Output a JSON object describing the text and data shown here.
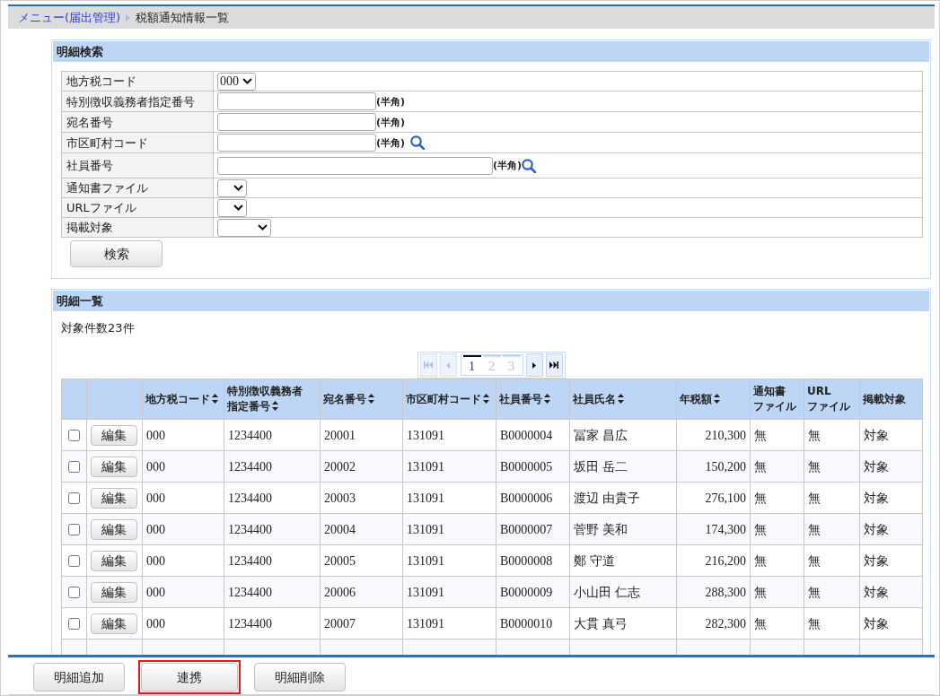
{
  "breadcrumb": {
    "link": "メニュー(届出管理)",
    "current": "税額通知情報一覧"
  },
  "search_panel": {
    "title": "明細検索",
    "fields": [
      {
        "label": "地方税コード",
        "kind": "select",
        "value": "000"
      },
      {
        "label": "特別徴収義務者指定番号",
        "kind": "text",
        "note": "(半角)"
      },
      {
        "label": "宛名番号",
        "kind": "text",
        "note": "(半角)"
      },
      {
        "label": "市区町村コード",
        "kind": "text",
        "note": "(半角)",
        "lookup": true
      },
      {
        "label": "社員番号",
        "kind": "long_text",
        "note": "(半角)",
        "lookup": true
      },
      {
        "label": "通知書ファイル",
        "kind": "select"
      },
      {
        "label": "URLファイル",
        "kind": "select"
      },
      {
        "label": "掲載対象",
        "kind": "wide_select"
      }
    ],
    "search_button": "検索"
  },
  "list_panel": {
    "title": "明細一覧",
    "count": "対象件数23件",
    "pager": {
      "first_disabled": true,
      "prev_disabled": true,
      "pages": [
        {
          "label": "1",
          "selected": true
        },
        {
          "label": "2",
          "selected": false
        },
        {
          "label": "3",
          "selected": false
        }
      ],
      "next_disabled": false,
      "last_disabled": false
    },
    "table": {
      "columns": [
        {
          "lines": [
            "地方税コード"
          ],
          "sortable": true,
          "kind": "code"
        },
        {
          "lines": [
            "特別徴収義務者",
            "指定番号"
          ],
          "sortable": true,
          "kind": "code"
        },
        {
          "lines": [
            "宛名番号"
          ],
          "sortable": true,
          "kind": "code"
        },
        {
          "lines": [
            "市区町村コード"
          ],
          "sortable": true,
          "kind": "code"
        },
        {
          "lines": [
            "社員番号"
          ],
          "sortable": true,
          "kind": "code"
        },
        {
          "lines": [
            "社員氏名"
          ],
          "sortable": true,
          "kind": "text"
        },
        {
          "lines": [
            "年税額"
          ],
          "sortable": true,
          "kind": "amount"
        },
        {
          "lines": [
            "通知書",
            "ファイル"
          ],
          "sortable": false,
          "kind": "text"
        },
        {
          "lines": [
            "URL",
            "ファイル"
          ],
          "sortable": false,
          "kind": "text"
        },
        {
          "lines": [
            "掲載対象"
          ],
          "sortable": false,
          "kind": "text"
        }
      ],
      "rows": [
        {
          "checked": false,
          "edit": "編集",
          "cells": [
            "000",
            "1234400",
            "20001",
            "131091",
            "B0000004",
            "冨家 昌広",
            "210,300",
            "無",
            "無",
            "対象"
          ]
        },
        {
          "checked": false,
          "edit": "編集",
          "cells": [
            "000",
            "1234400",
            "20002",
            "131091",
            "B0000005",
            "坂田 岳二",
            "150,200",
            "無",
            "無",
            "対象"
          ]
        },
        {
          "checked": false,
          "edit": "編集",
          "cells": [
            "000",
            "1234400",
            "20003",
            "131091",
            "B0000006",
            "渡辺 由貴子",
            "276,100",
            "無",
            "無",
            "対象"
          ]
        },
        {
          "checked": false,
          "edit": "編集",
          "cells": [
            "000",
            "1234400",
            "20004",
            "131091",
            "B0000007",
            "菅野 美和",
            "174,300",
            "無",
            "無",
            "対象"
          ]
        },
        {
          "checked": false,
          "edit": "編集",
          "cells": [
            "000",
            "1234400",
            "20005",
            "131091",
            "B0000008",
            "鄭 守道",
            "216,200",
            "無",
            "無",
            "対象"
          ]
        },
        {
          "checked": false,
          "edit": "編集",
          "cells": [
            "000",
            "1234400",
            "20006",
            "131091",
            "B0000009",
            "小山田 仁志",
            "288,300",
            "無",
            "無",
            "対象"
          ]
        },
        {
          "checked": false,
          "edit": "編集",
          "cells": [
            "000",
            "1234400",
            "20007",
            "131091",
            "B0000010",
            "大貫 真弓",
            "282,300",
            "無",
            "無",
            "対象"
          ]
        }
      ]
    }
  },
  "footer_buttons": [
    {
      "label": "明細追加",
      "highlighted": false
    },
    {
      "label": "連携",
      "highlighted": true
    },
    {
      "label": "明細削除",
      "highlighted": false
    }
  ]
}
